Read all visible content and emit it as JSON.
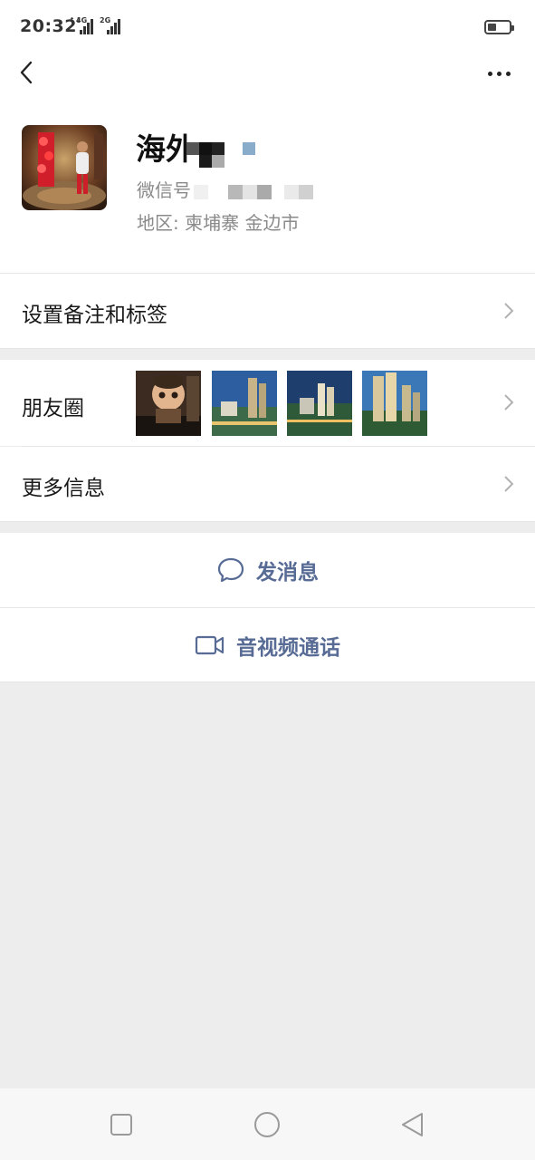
{
  "status_bar": {
    "time": "20:32",
    "network_1": "4G",
    "network_2": "2G",
    "battery_level": 0.4
  },
  "nav": {
    "back_icon": "chevron-left-icon",
    "more_icon": "more-dots-icon"
  },
  "profile": {
    "name": "海外",
    "wechat_id_label": "微信号",
    "region_label": "地区:",
    "region_value": "柬埔寨  金边市"
  },
  "rows": {
    "remark_label": "设置备注和标签",
    "moments_label": "朋友圈",
    "more_info_label": "更多信息"
  },
  "actions": {
    "message_label": "发消息",
    "call_label": "音视频通话"
  },
  "colors": {
    "link": "#576b95",
    "background": "#ededed"
  }
}
